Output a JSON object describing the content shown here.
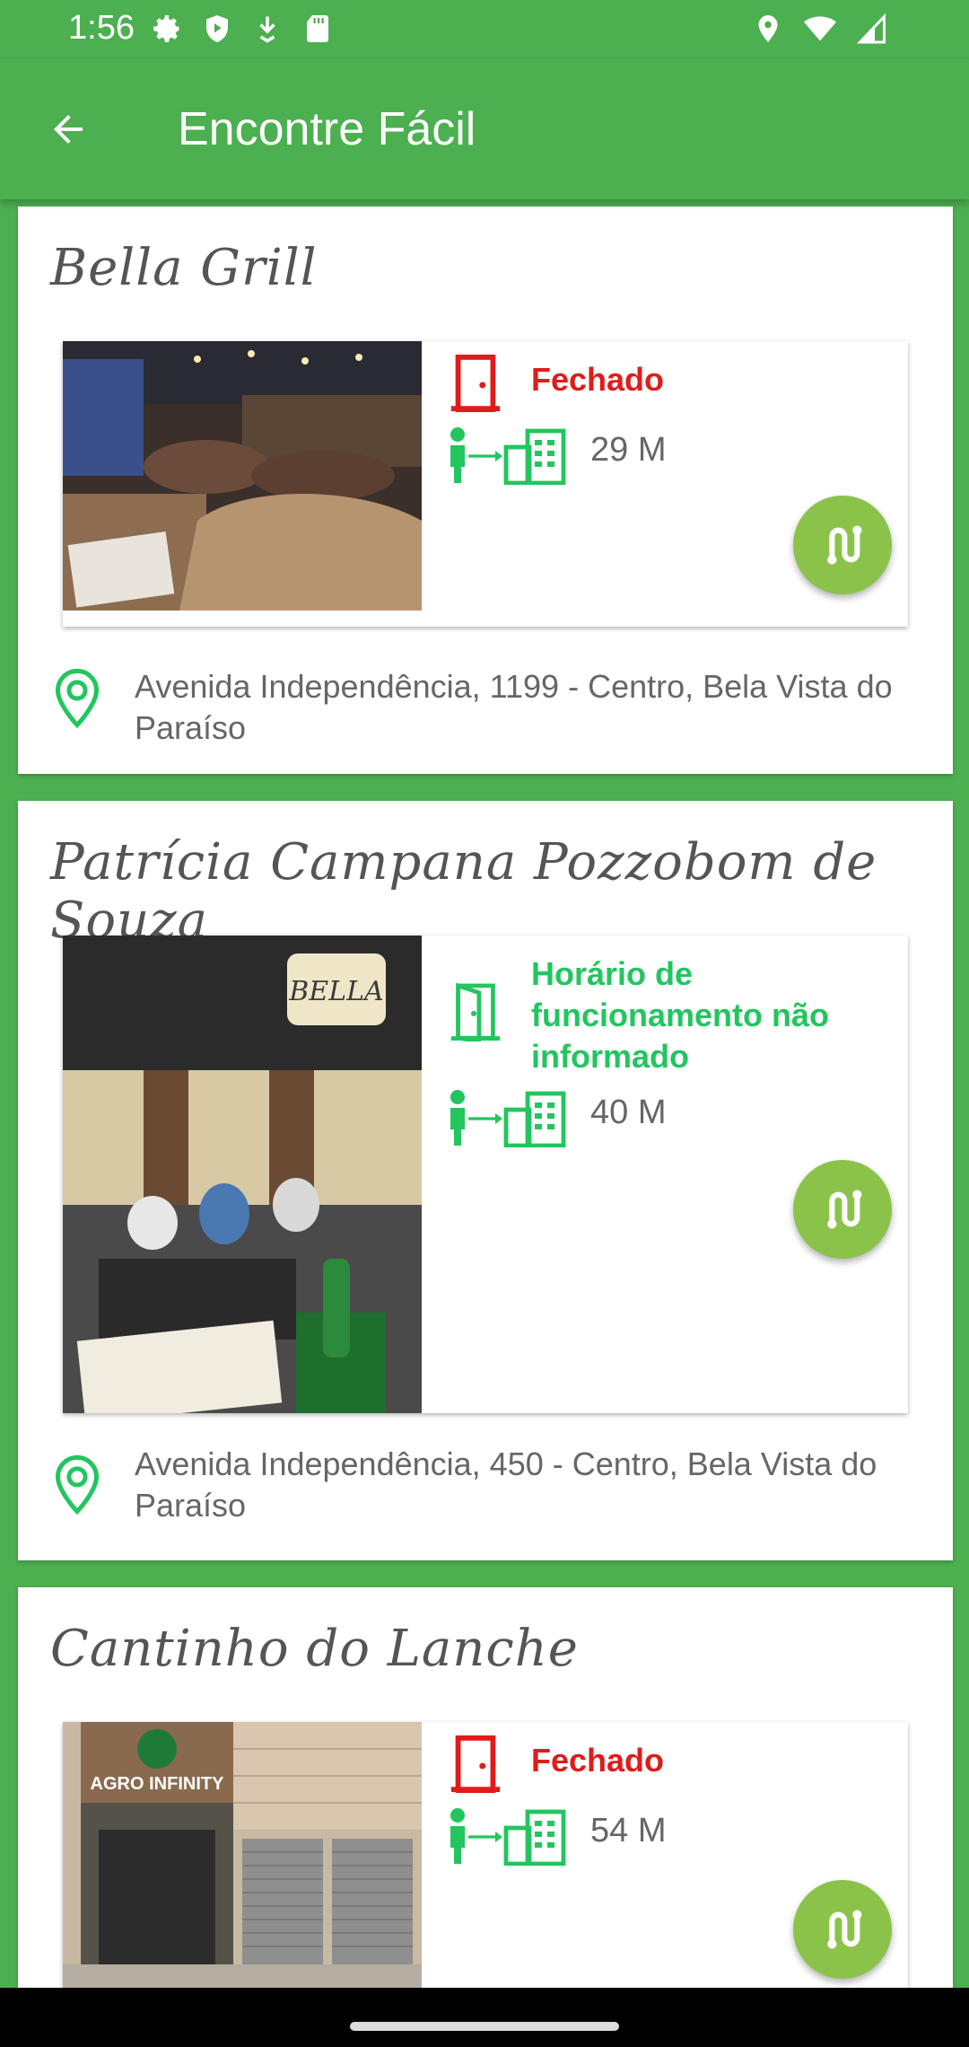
{
  "status_bar": {
    "time": "1:56",
    "left_icons": [
      "settings-icon",
      "shield-play-icon",
      "download-icon",
      "sd-card-icon"
    ],
    "right_icons": [
      "location-icon",
      "wifi-icon",
      "signal-icon"
    ]
  },
  "app_bar": {
    "back_icon": "arrow-left-icon",
    "title": "Encontre Fácil"
  },
  "places": [
    {
      "name": "Bella Grill",
      "status": "Fechado",
      "status_kind": "closed",
      "distance": "29 M",
      "address": "Avenida Independência, 1199 - Centro, Bela Vista do Paraíso"
    },
    {
      "name": "Patrícia Campana Pozzobom de Souza",
      "status": "Horário de funcionamento não informado",
      "status_kind": "unknown",
      "distance": "40 M",
      "address": "Avenida Independência, 450 - Centro, Bela Vista do Paraíso",
      "photo_sign": "BELLA"
    },
    {
      "name": "Cantinho do Lanche",
      "status": "Fechado",
      "status_kind": "closed",
      "distance": "54 M",
      "address": "",
      "photo_sign": "AGRO INFINITY"
    }
  ],
  "colors": {
    "primary": "#4caf50",
    "closed": "#e01b1b",
    "open_unknown": "#22c55e",
    "route_button": "#8bc34a"
  }
}
